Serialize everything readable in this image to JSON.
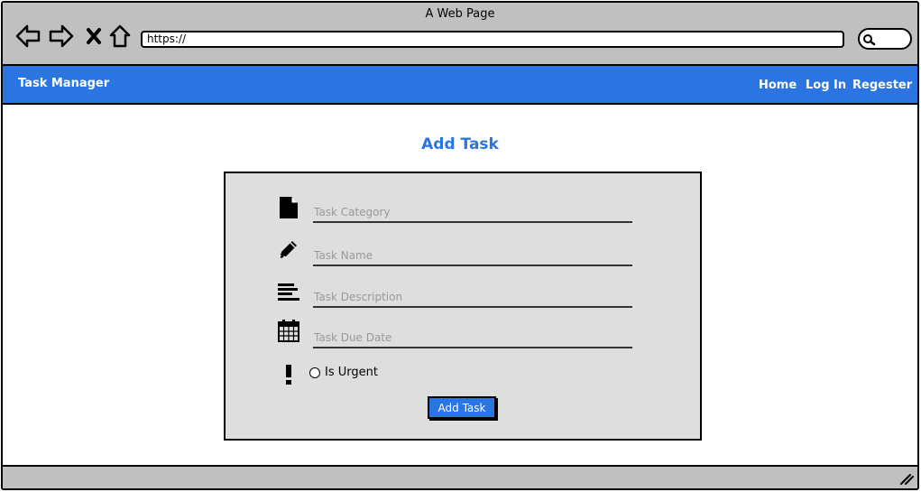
{
  "browser": {
    "window_title": "A Web Page",
    "url": "https://"
  },
  "app": {
    "brand": "Task Manager",
    "nav": [
      "Home",
      "Log In",
      "Regester"
    ],
    "accent_color": "#2a75e2"
  },
  "form": {
    "title": "Add Task",
    "fields": [
      {
        "icon": "file-icon",
        "placeholder": "Task Category"
      },
      {
        "icon": "pencil-icon",
        "placeholder": "Task Name"
      },
      {
        "icon": "align-left-icon",
        "placeholder": "Task Description"
      },
      {
        "icon": "calendar-icon",
        "placeholder": "Task Due Date"
      }
    ],
    "urgent": {
      "icon": "exclamation-icon",
      "label": "Is Urgent"
    },
    "submit_label": "Add Task"
  }
}
